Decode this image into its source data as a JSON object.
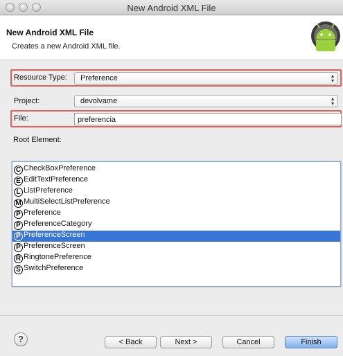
{
  "window": {
    "title": "New Android XML File"
  },
  "header": {
    "title": "New Android XML File",
    "description": "Creates a new Android XML file."
  },
  "form": {
    "resource_type_label": "Resource Type:",
    "resource_type_value": "Preference",
    "project_label": "Project:",
    "project_value": "devolvame",
    "file_label": "File:",
    "file_value": "preferencia",
    "root_element_label": "Root Element:"
  },
  "root_elements": [
    {
      "icon": "C",
      "label": "CheckBoxPreference"
    },
    {
      "icon": "E",
      "label": "EditTextPreference"
    },
    {
      "icon": "L",
      "label": "ListPreference"
    },
    {
      "icon": "M",
      "label": "MultiSelectListPreference"
    },
    {
      "icon": "P",
      "label": "Preference"
    },
    {
      "icon": "P",
      "label": "PreferenceCategory"
    },
    {
      "icon": "P",
      "label": "PreferenceScreen",
      "selected": true
    },
    {
      "icon": "P",
      "label": "PreferenceScreen"
    },
    {
      "icon": "R",
      "label": "RingtonePreference"
    },
    {
      "icon": "S",
      "label": "SwitchPreference"
    }
  ],
  "buttons": {
    "help": "?",
    "back": "< Back",
    "next": "Next >",
    "cancel": "Cancel",
    "finish": "Finish"
  },
  "colors": {
    "highlight": "#e0605a",
    "selection": "#3875d7"
  },
  "icons": {
    "logo": "android-robot-icon",
    "help": "help-icon"
  }
}
